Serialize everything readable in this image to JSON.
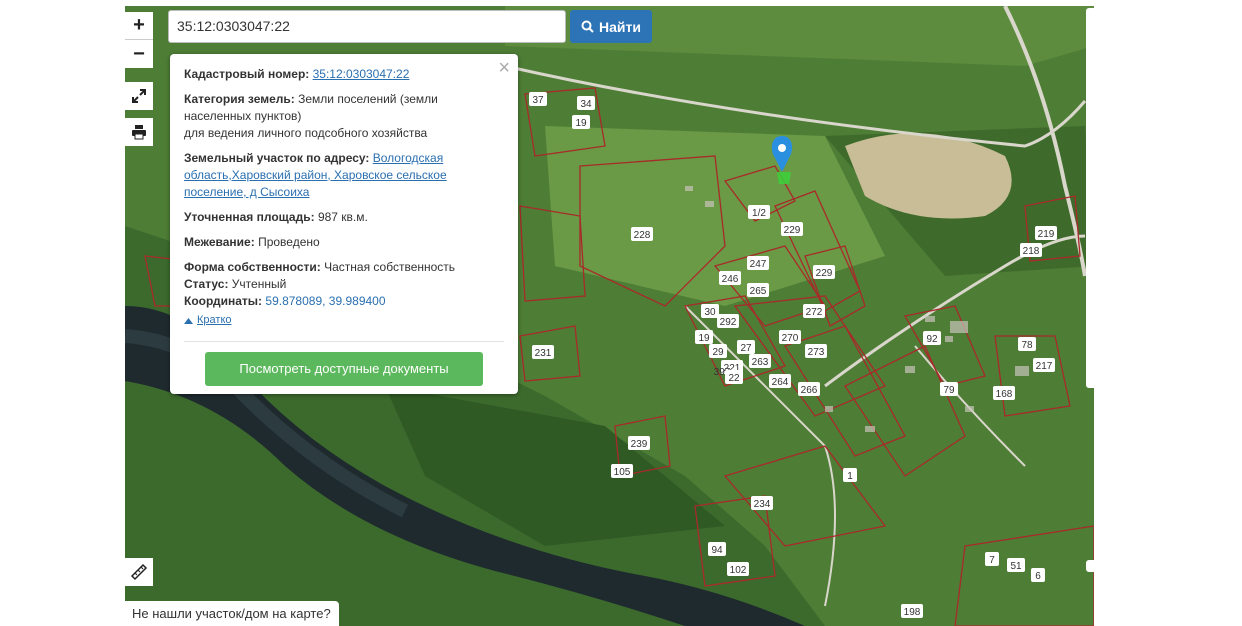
{
  "search": {
    "value": "35:12:0303047:22",
    "button_label": "Найти"
  },
  "controls": {
    "zoom_in": "+",
    "zoom_out": "−"
  },
  "popup": {
    "cadastral_label": "Кадастровый номер:",
    "cadastral_value": "35:12:0303047:22",
    "category_label": "Категория земель:",
    "category_value_1": "Земли поселений (земли",
    "category_value_2": "населенных пунктов)",
    "category_value_3": "для ведения личного подсобного хозяйства",
    "address_label": "Земельный участок по адресу:",
    "address_1": "Вологодская",
    "address_2": "область,Харовский район, Харовское сельское",
    "address_3": "поселение, д Сысоиха",
    "area_label": "Уточненная площадь:",
    "area_value": "987 кв.м.",
    "survey_label": "Межевание:",
    "survey_value": "Проведено",
    "ownership_label": "Форма собственности:",
    "ownership_value": "Частная собственность",
    "status_label": "Статус:",
    "status_value": "Учтенный",
    "coords_label": "Координаты:",
    "coords_value": "59.878089, 39.989400",
    "brief_link": "Кратко",
    "documents_button": "Посмотреть доступные документы",
    "close": "×"
  },
  "not_found_text": "Не нашли участок/дом на карте?",
  "plot_labels": [
    "37",
    "34",
    "19",
    "228",
    "1/2",
    "229",
    "229",
    "247",
    "246",
    "265",
    "272",
    "273",
    "270",
    "30",
    "292",
    "19",
    "29",
    "27",
    "263",
    "221",
    "397",
    "22",
    "264",
    "266",
    "231",
    "92",
    "79",
    "219",
    "218",
    "78",
    "217",
    "168",
    "239",
    "105",
    "234",
    "94",
    "102",
    "198",
    "7",
    "51",
    "6",
    "1"
  ],
  "colors": {
    "search_button": "#2d74b7",
    "documents_button": "#5cb85c",
    "link": "#2a6fb0",
    "plot_outline": "#a82a2a",
    "marker": "#2b8fe0"
  }
}
